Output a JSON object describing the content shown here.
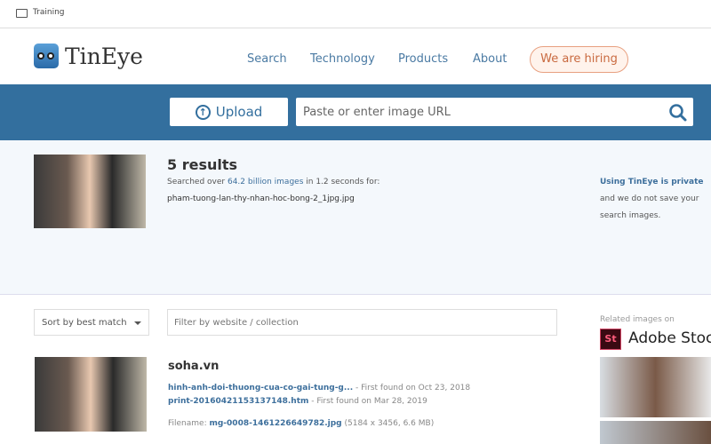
{
  "browser": {
    "folder_label": "Training"
  },
  "header": {
    "brand": "TinEye",
    "nav": [
      "Search",
      "Technology",
      "Products",
      "About"
    ],
    "hiring": "We are hiring"
  },
  "search": {
    "upload_label": "Upload",
    "url_placeholder": "Paste or enter image URL"
  },
  "summary": {
    "count": "5 results",
    "searched_prefix": "Searched over ",
    "searched_link": "64.2 billion images",
    "searched_suffix": " in 1.2 seconds for:",
    "filename": "pham-tuong-lan-thy-nhan-hoc-bong-2_1jpg.jpg",
    "privacy_link": "Using TinEye is private",
    "privacy_text1": "and we do not save your",
    "privacy_text2": "search images."
  },
  "controls": {
    "sort": "Sort by best match",
    "filter_placeholder": "Filter by website / collection"
  },
  "results": [
    {
      "site": "soha.vn",
      "links": [
        {
          "text": "hinh-anh-doi-thuong-cua-co-gai-tung-g...",
          "found": " - First found on Oct 23, 2018"
        },
        {
          "text": "print-20160421153137148.htm",
          "found": " - First found on Mar 28, 2019"
        }
      ],
      "filename_label": "Filename: ",
      "filename": "mg-0008-1461226649782.jpg",
      "meta": " (5184 x 3456, 6.6 MB)"
    }
  ],
  "related": {
    "label": "Related images on",
    "provider": "Adobe Stock",
    "provider_logo": "St"
  },
  "colors": {
    "band": "#336f9e",
    "link": "#3d6f9c",
    "hiring": "#c96a40"
  }
}
